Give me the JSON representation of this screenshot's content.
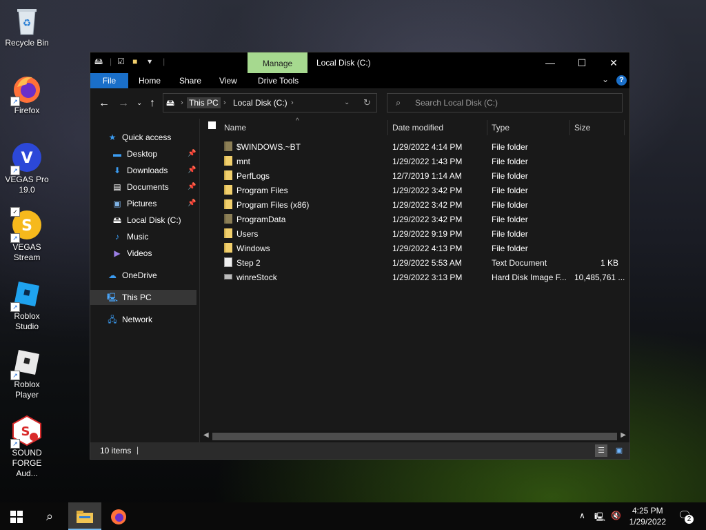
{
  "desktop": {
    "icons": [
      {
        "label": "Recycle Bin"
      },
      {
        "label": "Firefox"
      },
      {
        "label": "VEGAS Pro 19.0"
      },
      {
        "label": "VEGAS Stream"
      },
      {
        "label": "Roblox Studio"
      },
      {
        "label": "Roblox Player"
      },
      {
        "label": "SOUND FORGE Aud..."
      }
    ]
  },
  "window": {
    "title": "Local Disk (C:)",
    "manage_tab": "Manage",
    "ribbon_tabs": {
      "file": "File",
      "home": "Home",
      "share": "Share",
      "view": "View",
      "drive_tools": "Drive Tools"
    },
    "address": {
      "seg1": "This PC",
      "seg2": "Local Disk (C:)"
    },
    "search_placeholder": "Search Local Disk (C:)",
    "nav": {
      "quick_access": "Quick access",
      "desktop": "Desktop",
      "downloads": "Downloads",
      "documents": "Documents",
      "pictures": "Pictures",
      "local_disk": "Local Disk (C:)",
      "music": "Music",
      "videos": "Videos",
      "onedrive": "OneDrive",
      "this_pc": "This PC",
      "network": "Network"
    },
    "columns": {
      "name": "Name",
      "date": "Date modified",
      "type": "Type",
      "size": "Size"
    },
    "files": [
      {
        "name": "$WINDOWS.~BT",
        "date": "1/29/2022 4:14 PM",
        "type": "File folder",
        "size": ""
      },
      {
        "name": "mnt",
        "date": "1/29/2022 1:43 PM",
        "type": "File folder",
        "size": ""
      },
      {
        "name": "PerfLogs",
        "date": "12/7/2019 1:14 AM",
        "type": "File folder",
        "size": ""
      },
      {
        "name": "Program Files",
        "date": "1/29/2022 3:42 PM",
        "type": "File folder",
        "size": ""
      },
      {
        "name": "Program Files (x86)",
        "date": "1/29/2022 3:42 PM",
        "type": "File folder",
        "size": ""
      },
      {
        "name": "ProgramData",
        "date": "1/29/2022 3:42 PM",
        "type": "File folder",
        "size": ""
      },
      {
        "name": "Users",
        "date": "1/29/2022 9:19 PM",
        "type": "File folder",
        "size": ""
      },
      {
        "name": "Windows",
        "date": "1/29/2022 4:13 PM",
        "type": "File folder",
        "size": ""
      },
      {
        "name": "Step 2",
        "date": "1/29/2022 5:53 AM",
        "type": "Text Document",
        "size": "1 KB"
      },
      {
        "name": "winreStock",
        "date": "1/29/2022 3:13 PM",
        "type": "Hard Disk Image F...",
        "size": "10,485,761 ..."
      }
    ],
    "status_count": "10 items"
  },
  "taskbar": {
    "time": "4:25 PM",
    "date": "1/29/2022",
    "notification_count": "2"
  },
  "colors": {
    "accent": "#1a6fc9",
    "manage": "#a6d98f"
  }
}
